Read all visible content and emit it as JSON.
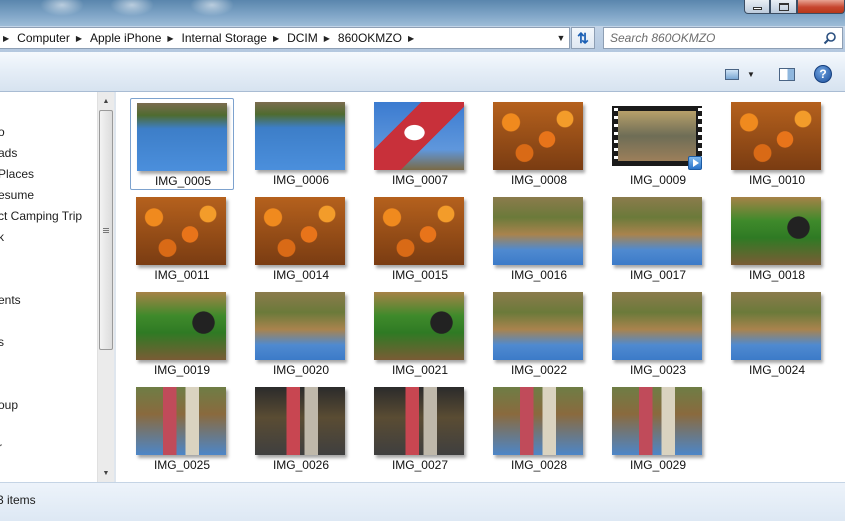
{
  "breadcrumb": [
    "Computer",
    "Apple iPhone",
    "Internal Storage",
    "DCIM",
    "860OKMZO"
  ],
  "search": {
    "placeholder": "Search 860OKMZO"
  },
  "nav_items": [
    "o",
    "ads",
    "Places",
    "esume",
    "ct Camping Trip",
    "k",
    "ents",
    "s",
    "oup",
    "r"
  ],
  "files": [
    {
      "name": "IMG_0005",
      "kind": "sky",
      "selected": true
    },
    {
      "name": "IMG_0006",
      "kind": "sky"
    },
    {
      "name": "IMG_0007",
      "kind": "sign"
    },
    {
      "name": "IMG_0008",
      "kind": "pumpkin"
    },
    {
      "name": "IMG_0009",
      "kind": "video"
    },
    {
      "name": "IMG_0010",
      "kind": "pumpkin"
    },
    {
      "name": "IMG_0011",
      "kind": "pumpkin"
    },
    {
      "name": "IMG_0014",
      "kind": "pumpkin"
    },
    {
      "name": "IMG_0015",
      "kind": "pumpkin"
    },
    {
      "name": "IMG_0016",
      "kind": "tractor"
    },
    {
      "name": "IMG_0017",
      "kind": "tractor"
    },
    {
      "name": "IMG_0018",
      "kind": "green"
    },
    {
      "name": "IMG_0019",
      "kind": "green"
    },
    {
      "name": "IMG_0020",
      "kind": "tractor"
    },
    {
      "name": "IMG_0021",
      "kind": "green"
    },
    {
      "name": "IMG_0022",
      "kind": "tractor"
    },
    {
      "name": "IMG_0023",
      "kind": "tractor"
    },
    {
      "name": "IMG_0024",
      "kind": "tractor"
    },
    {
      "name": "IMG_0025",
      "kind": "kids"
    },
    {
      "name": "IMG_0026",
      "kind": "kidsdark"
    },
    {
      "name": "IMG_0027",
      "kind": "kidsdark"
    },
    {
      "name": "IMG_0028",
      "kind": "kids"
    },
    {
      "name": "IMG_0029",
      "kind": "kids"
    }
  ],
  "status": {
    "item_count": "3 items"
  },
  "icons": {
    "search": "search-icon",
    "refresh": "refresh-icon",
    "views": "views-icon",
    "preview_pane": "preview-pane-icon",
    "help": "help-icon",
    "video_overlay": "play-icon"
  },
  "colors": {
    "selection_border": "#7da2ce",
    "address_bg": "#c3d4e7",
    "toolbar_bg": "#e3ecf6"
  }
}
